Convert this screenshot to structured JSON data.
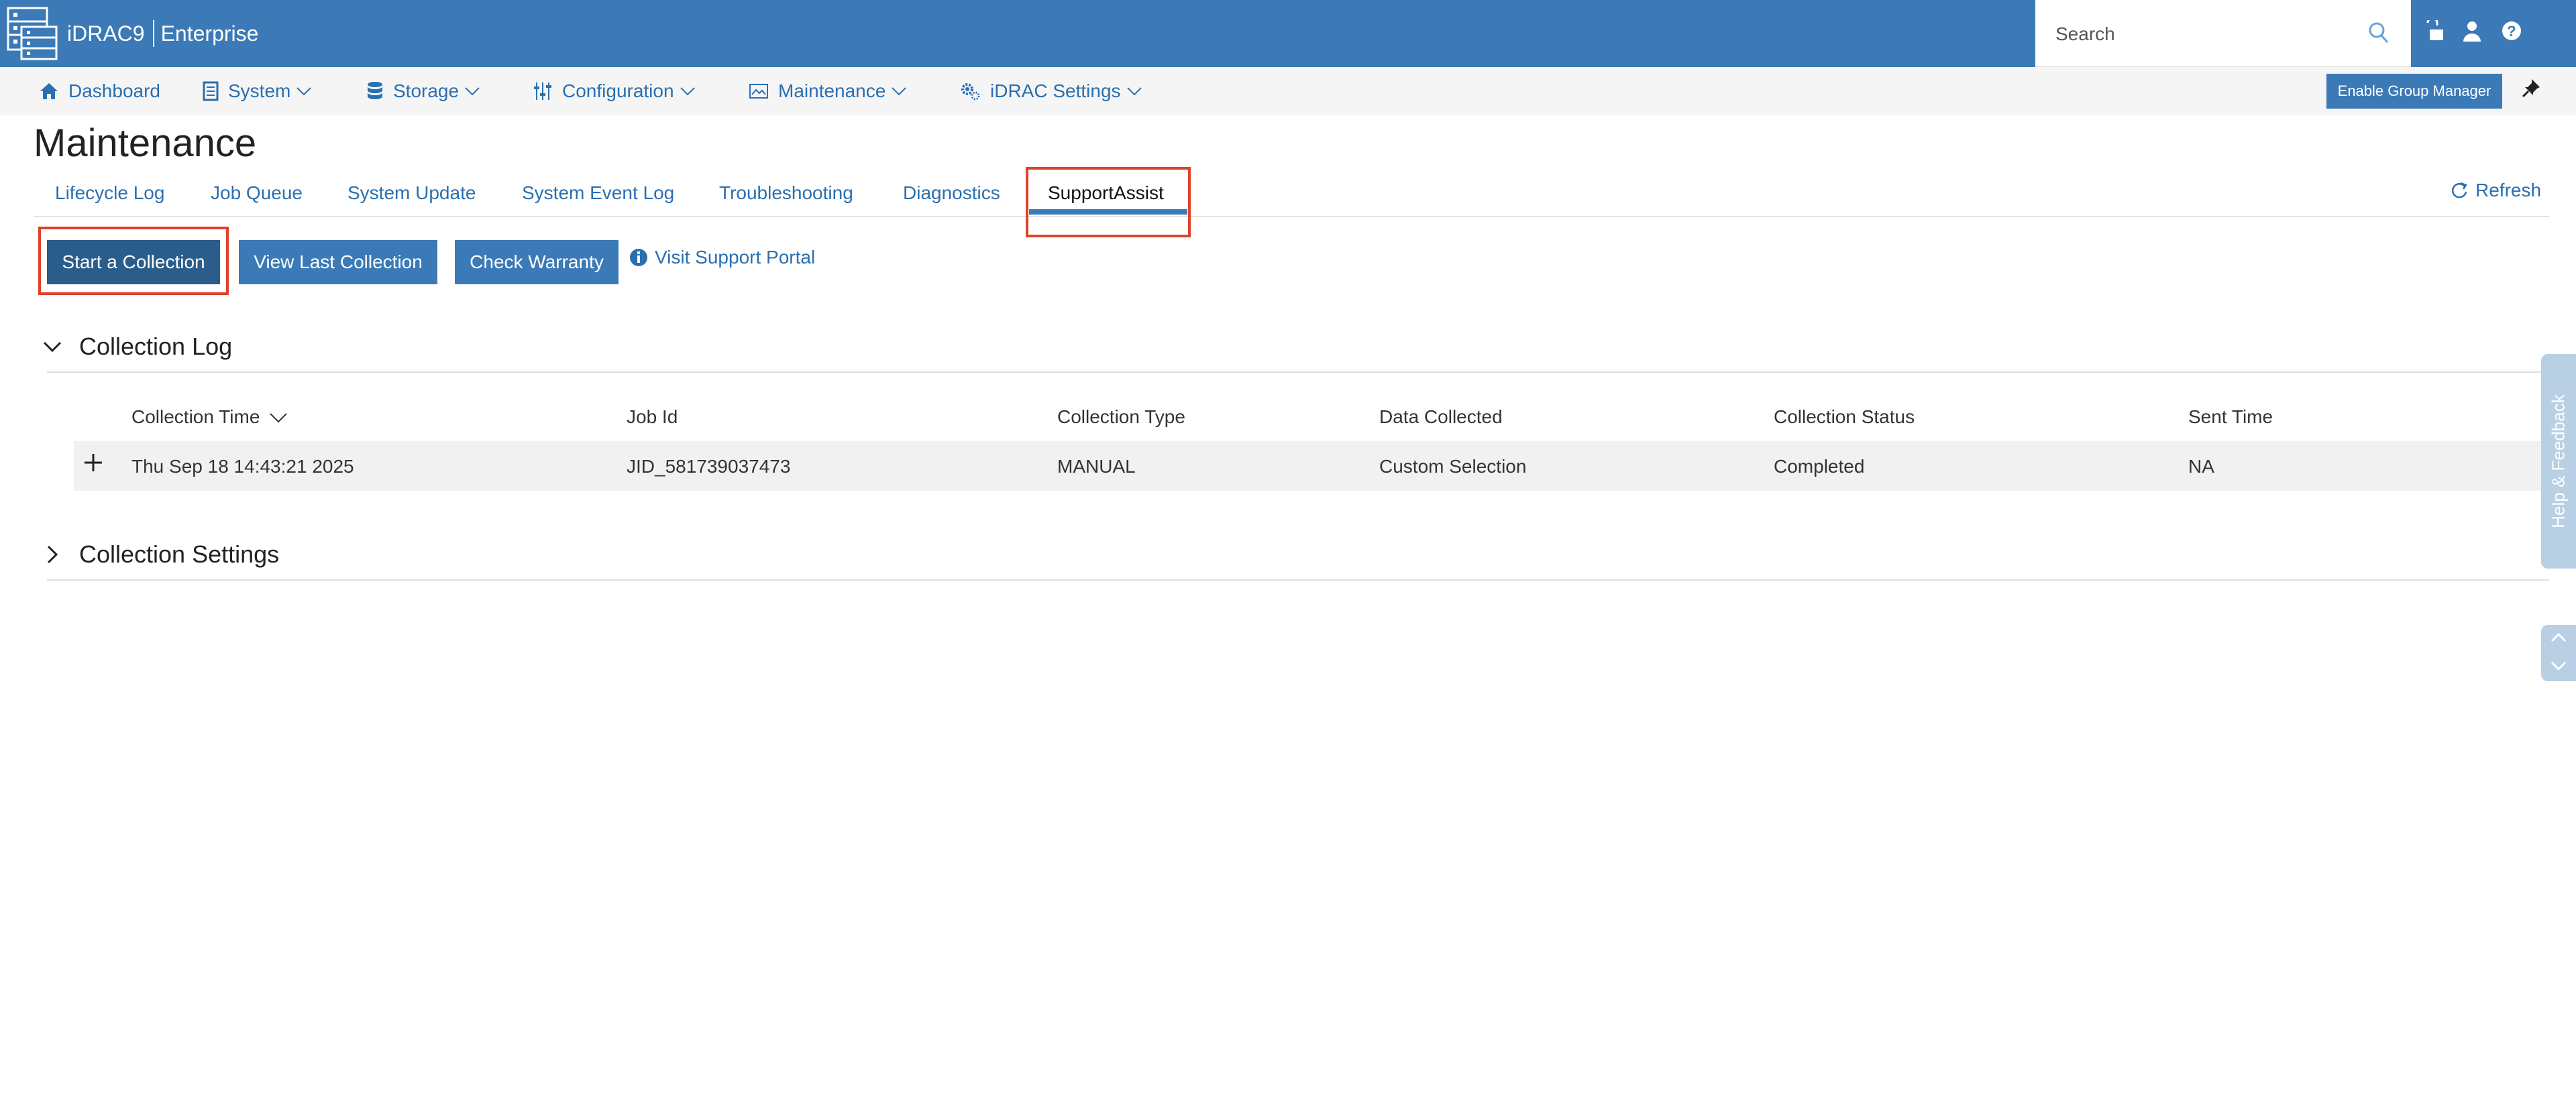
{
  "header": {
    "product": "iDRAC9",
    "edition": "Enterprise",
    "search_placeholder": "Search"
  },
  "nav": {
    "items": [
      {
        "label": "Dashboard",
        "icon": "home-icon"
      },
      {
        "label": "System",
        "icon": "server-icon"
      },
      {
        "label": "Storage",
        "icon": "database-icon"
      },
      {
        "label": "Configuration",
        "icon": "sliders-icon"
      },
      {
        "label": "Maintenance",
        "icon": "monitor-icon"
      },
      {
        "label": "iDRAC Settings",
        "icon": "gears-icon"
      }
    ],
    "group_manager_label": "Enable Group Manager"
  },
  "page": {
    "title": "Maintenance",
    "refresh_label": "Refresh",
    "tabs": [
      {
        "label": "Lifecycle Log"
      },
      {
        "label": "Job Queue"
      },
      {
        "label": "System Update"
      },
      {
        "label": "System Event Log"
      },
      {
        "label": "Troubleshooting"
      },
      {
        "label": "Diagnostics"
      },
      {
        "label": "SupportAssist",
        "active": true
      }
    ]
  },
  "actions": {
    "start_collection": "Start a Collection",
    "view_last_collection": "View Last Collection",
    "check_warranty": "Check Warranty",
    "visit_support_portal": "Visit Support Portal"
  },
  "collection_log": {
    "title": "Collection Log",
    "columns": [
      "Collection Time",
      "Job Id",
      "Collection Type",
      "Data Collected",
      "Collection Status",
      "Sent Time"
    ],
    "rows": [
      {
        "collection_time": "Thu Sep 18 14:43:21 2025",
        "job_id": "JID_581739037473",
        "collection_type": "MANUAL",
        "data_collected": "Custom Selection",
        "collection_status": "Completed",
        "sent_time": "NA"
      }
    ]
  },
  "collection_settings": {
    "title": "Collection Settings"
  },
  "side": {
    "help_feedback": "Help & Feedback"
  },
  "colors": {
    "header_blue": "#3b7ab7",
    "link_blue": "#2a6fb0",
    "active_button": "#2b5d8a",
    "highlight_red": "#e0412b"
  }
}
